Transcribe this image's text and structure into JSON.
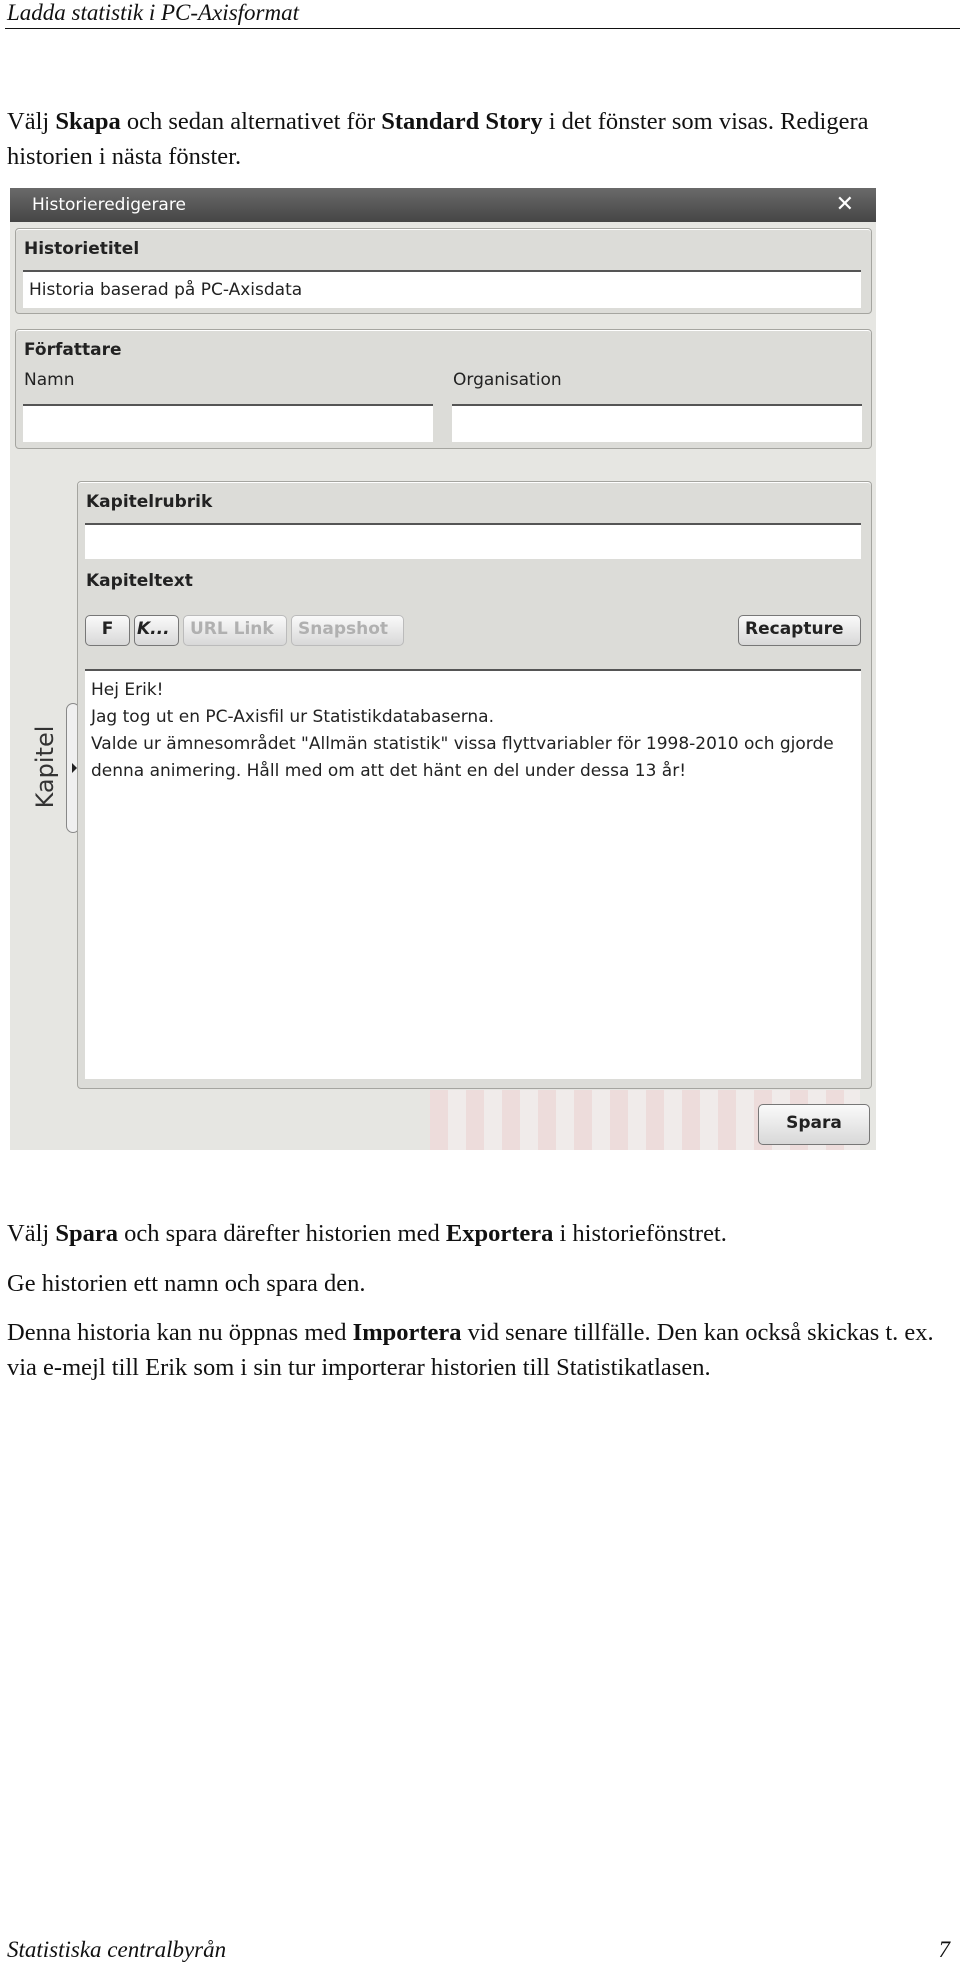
{
  "header": {
    "title": "Ladda statistik i PC-Axisformat"
  },
  "intro": {
    "t1": "Välj ",
    "b1": "Skapa",
    "t2": " och sedan alternativet för ",
    "b2": "Standard Story",
    "t3": " i det fönster som visas. Redigera historien i nästa fönster."
  },
  "dialog": {
    "title": "Historieredigerare",
    "close_icon": "close-x",
    "story_title_label": "Historietitel",
    "story_title_value": "Historia baserad på PC-Axisdata",
    "author_label": "Författare",
    "name_label": "Namn",
    "name_value": "",
    "org_label": "Organisation",
    "org_value": "",
    "chapter_tab_label": "Kapitel",
    "chapter_heading_label": "Kapitelrubrik",
    "chapter_heading_value": "",
    "chapter_text_label": "Kapiteltext",
    "toolbar": {
      "bold": "F",
      "italic": "K...",
      "url_link": "URL Link",
      "snapshot": "Snapshot",
      "recapture": "Recapture"
    },
    "chapter_text_value": "Hej Erik!\nJag tog ut en PC-Axisfil ur Statistikdatabaserna.\nValde ur ämnesområdet \"Allmän statistik\" vissa flyttvariabler för 1998-2010 och gjorde denna animering. Håll med om att det hänt en del under dessa 13 år!",
    "save_label": "Spara"
  },
  "after": {
    "p1": {
      "t1": "Välj ",
      "b1": "Spara",
      "t2": " och spara därefter historien med ",
      "b2": "Exportera",
      "t3": " i historiefönstret."
    },
    "p2": "Ge historien ett namn och spara den.",
    "p3": {
      "t1": "Denna historia kan nu öppnas med ",
      "b1": "Importera",
      "t2": " vid senare tillfälle. Den kan också skickas t. ex. via e-mejl till Erik som i sin tur importerar historien till Statistikatlasen."
    }
  },
  "footer": {
    "org": "Statistiska centralbyrån",
    "page": "7"
  }
}
